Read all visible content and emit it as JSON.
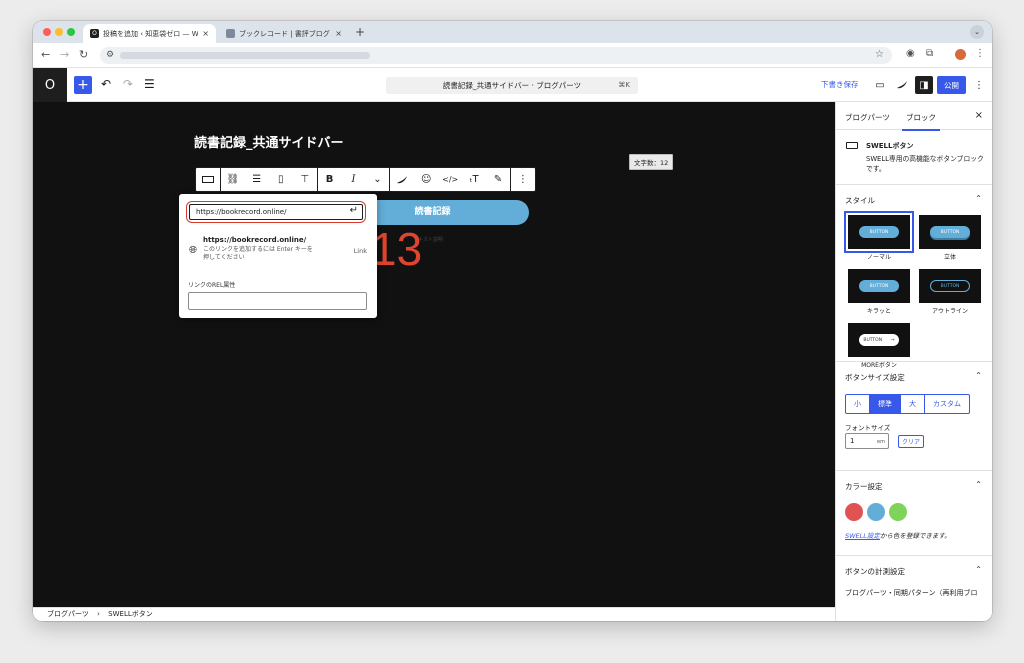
{
  "browser": {
    "tabs": [
      {
        "title": "投稿を追加 ‹ 知恵袋ゼロ — WordPress",
        "close": "×"
      },
      {
        "title": "ブックレコード | 書評ブログ",
        "close": "×"
      }
    ],
    "new_tab": "+",
    "tab_menu": "⌄"
  },
  "wp": {
    "logo": "O",
    "add": "+",
    "command_title": "読書記録_共通サイドバー · ブログパーツ",
    "command_shortcut": "⌘K",
    "save_draft": "下書き保存",
    "publish": "公開"
  },
  "editor": {
    "post_title": "読書記録_共通サイドバー",
    "word_count": "文字数：12",
    "button_text": "読書記録",
    "button_caption": "テキスト説明",
    "annotation": "13"
  },
  "link_popover": {
    "url_value": "https://bookrecord.online/",
    "suggestion_url": "https://bookrecord.online/",
    "suggestion_desc": "このリンクを追加するには Enter キーを押してください",
    "suggestion_type": "Link",
    "rel_label": "リンクのREL属性",
    "rel_value": ""
  },
  "breadcrumb": {
    "items": [
      "ブログパーツ",
      "SWELLボタン"
    ],
    "sep": "›"
  },
  "sidebar": {
    "tabs": [
      "ブログパーツ",
      "ブロック"
    ],
    "close": "×",
    "block_name": "SWELLボタン",
    "block_desc": "SWELL専用の高機能なボタンブロックです。",
    "style_title": "スタイル",
    "styles": [
      {
        "label": "ノーマル",
        "preview": "BUTTON"
      },
      {
        "label": "立体",
        "preview": "BUTTON"
      },
      {
        "label": "キラッと",
        "preview": "BUTTON"
      },
      {
        "label": "アウトライン",
        "preview": "BUTTON"
      },
      {
        "label": "MOREボタン",
        "preview": "BUTTON"
      }
    ],
    "size_title": "ボタンサイズ設定",
    "sizes": [
      "小",
      "標準",
      "大",
      "カスタム"
    ],
    "selected_size": "標準",
    "font_size_label": "フォントサイズ",
    "font_size_value": "1",
    "font_size_unit": "em",
    "clear": "クリア",
    "color_title": "カラー設定",
    "colors": [
      "#e05353",
      "#62aed8",
      "#7fd35a"
    ],
    "color_note_link": "SWELL設定",
    "color_note_rest": "から色を登録できます。",
    "measure_title": "ボタンの計測設定",
    "measure_text": "ブログパーツ・同期パターン（再利用ブロ"
  }
}
